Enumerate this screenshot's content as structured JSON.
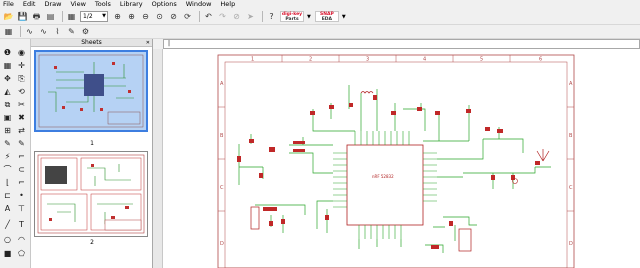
{
  "menu": [
    "File",
    "Edit",
    "Draw",
    "View",
    "Tools",
    "Library",
    "Options",
    "Window",
    "Help"
  ],
  "toolbar": {
    "sheet_select": "1/2",
    "brand1": "digi-key",
    "brand1_sub": "Parts",
    "brand2": "SNAP",
    "brand2_sub": "EDA"
  },
  "sheets_panel": {
    "title": "Sheets",
    "sheet1_label": "1",
    "sheet2_label": "2"
  },
  "frame": {
    "col_labels": [
      "1",
      "2",
      "3",
      "4",
      "5",
      "6"
    ],
    "row_labels": [
      "A",
      "B",
      "C",
      "D"
    ],
    "ic_label": "nRF 52832"
  },
  "colors": {
    "wire": "#2aa52a",
    "frame": "#b04848",
    "symbol": "#b02020",
    "selection": "#3d7ee0"
  },
  "icons": {
    "toolbar": [
      "open-icon",
      "save-icon",
      "print-icon",
      "cam-icon",
      "layout-icon",
      "zoom-fit-icon",
      "zoom-in-icon",
      "zoom-out-icon",
      "zoom-select-icon",
      "redraw-icon",
      "undo-icon",
      "redo-icon",
      "stop-icon",
      "go-icon",
      "help-icon"
    ],
    "toolbar2": [
      "grid-icon",
      "wire-icon",
      "net-icon",
      "bus-icon",
      "label-icon",
      "settings-icon"
    ]
  }
}
